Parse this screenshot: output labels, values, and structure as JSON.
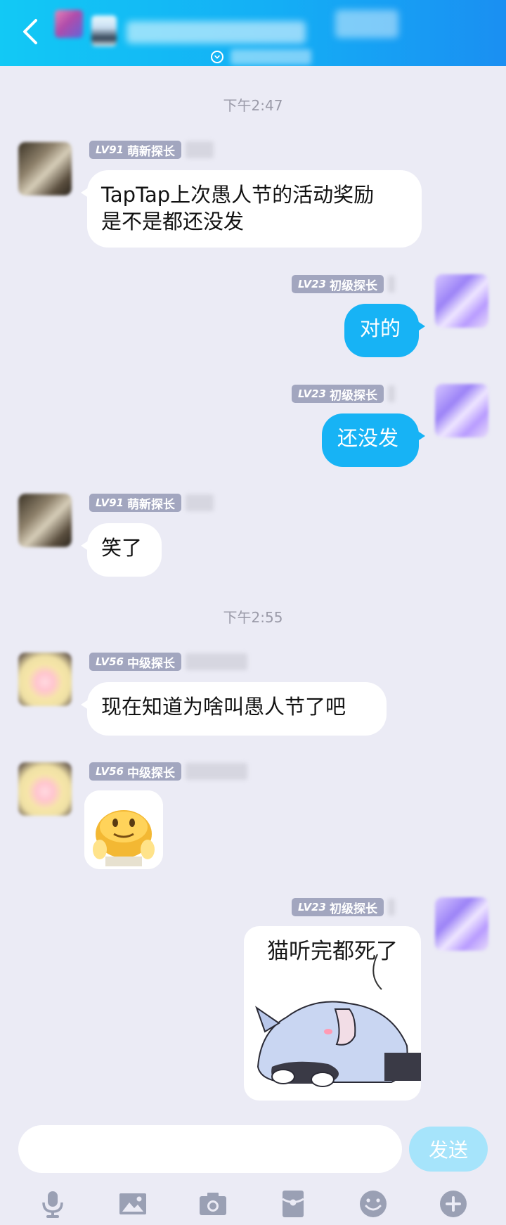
{
  "header": {
    "back_icon": "chevron-left-icon",
    "expand_icon": "chevron-down-circle-icon",
    "gradient": [
      "#12c9f5",
      "#1a8ff2"
    ]
  },
  "colors": {
    "background": "#ebebf5",
    "outgoing_bubble": "#17b3f5",
    "incoming_bubble": "#ffffff",
    "level_badge": "#a2a6bf",
    "send_button": "#a6e4fb"
  },
  "messages": [
    {
      "type": "time",
      "text": "下午2:47"
    },
    {
      "type": "incoming",
      "lv": "LV91",
      "rank": "萌新探长",
      "avatar": "avatar-dark",
      "lines": [
        "TapTap上次愚人节的活动奖励",
        "是不是都还没发"
      ]
    },
    {
      "type": "outgoing",
      "lv": "LV23",
      "rank": "初级探长",
      "avatar": "avatar-purple",
      "text": "对的"
    },
    {
      "type": "outgoing",
      "lv": "LV23",
      "rank": "初级探长",
      "avatar": "avatar-purple",
      "text": "还没发"
    },
    {
      "type": "incoming",
      "lv": "LV91",
      "rank": "萌新探长",
      "avatar": "avatar-dark",
      "text": "笑了"
    },
    {
      "type": "time",
      "text": "下午2:55"
    },
    {
      "type": "incoming",
      "lv": "LV56",
      "rank": "中级探长",
      "avatar": "avatar-blonde",
      "text": "现在知道为啥叫愚人节了吧"
    },
    {
      "type": "incoming-sticker",
      "lv": "LV56",
      "rank": "中级探长",
      "avatar": "avatar-blonde",
      "sticker": "yellow-blob-sticker"
    },
    {
      "type": "outgoing-sticker",
      "lv": "LV23",
      "rank": "初级探长",
      "avatar": "avatar-purple",
      "sticker": "sleeping-cat-sticker",
      "caption": "猫听完都死了"
    }
  ],
  "input": {
    "placeholder": "",
    "send_label": "发送"
  },
  "toolbar": [
    {
      "name": "microphone-icon"
    },
    {
      "name": "image-icon"
    },
    {
      "name": "camera-icon"
    },
    {
      "name": "red-packet-icon"
    },
    {
      "name": "emoji-icon"
    },
    {
      "name": "plus-icon"
    }
  ]
}
